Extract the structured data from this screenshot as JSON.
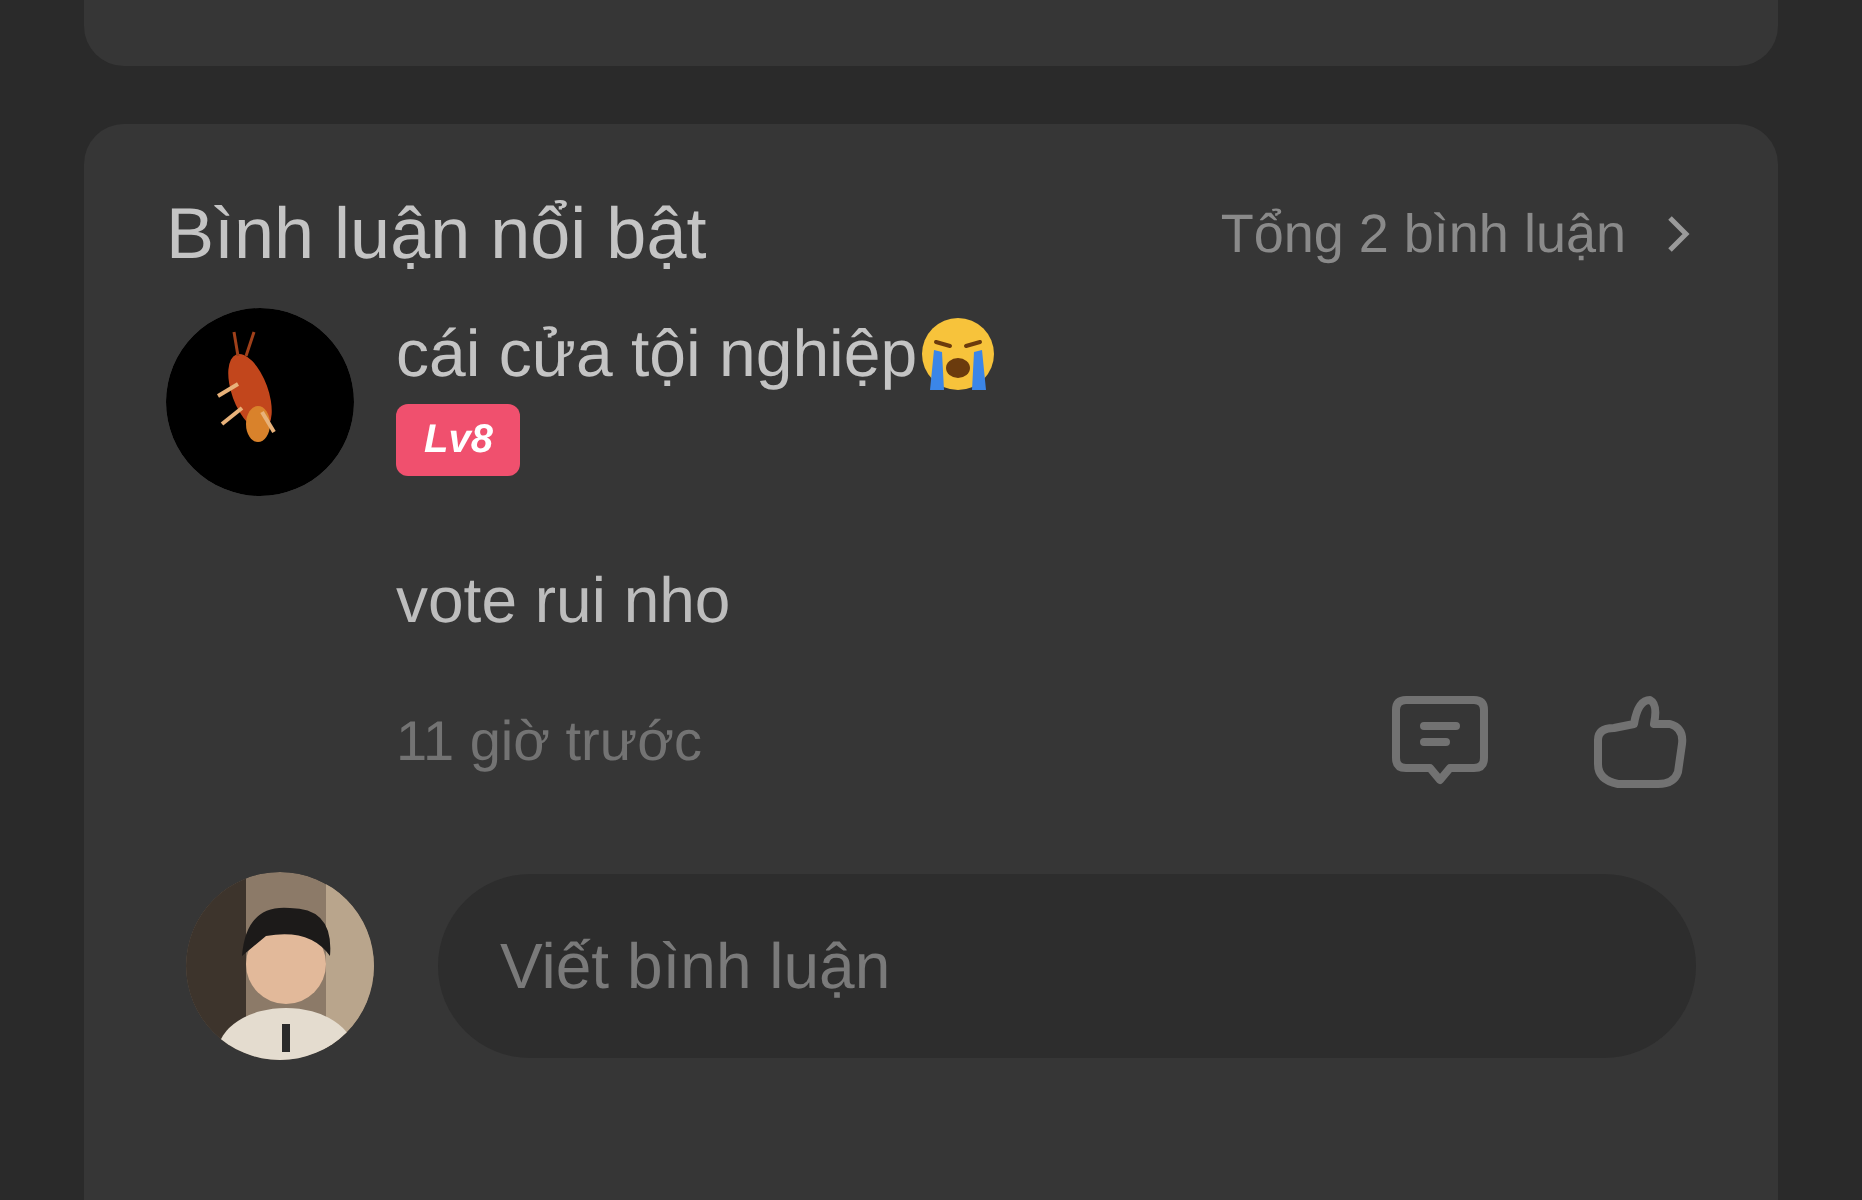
{
  "comments_section": {
    "title": "Bình luận nổi bật",
    "total": "Tổng 2 bình luận",
    "comments": [
      {
        "author": "cái cửa tội nghiệp",
        "level": "Lv8",
        "text": "vote rui nho",
        "time": "11 giờ trước"
      }
    ],
    "composer": {
      "placeholder": "Viết bình luận"
    }
  }
}
